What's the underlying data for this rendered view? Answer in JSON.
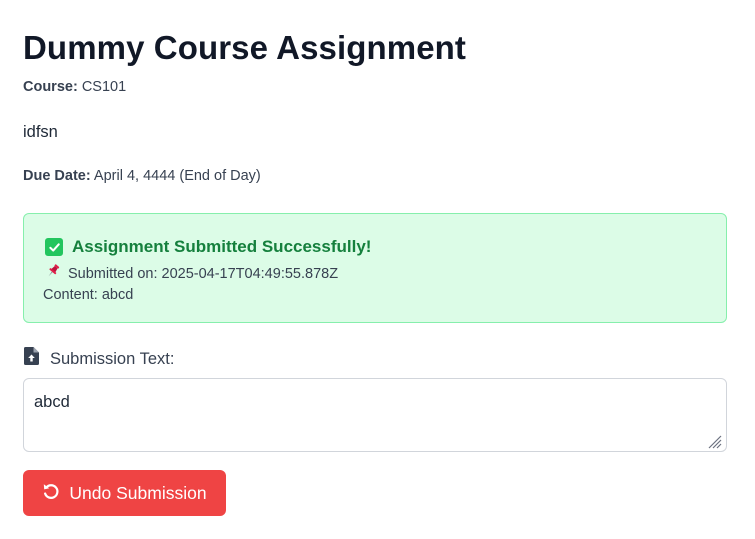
{
  "assignment": {
    "title": "Dummy Course Assignment",
    "course_label": "Course:",
    "course_value": "CS101",
    "description": "idfsn",
    "due_label": "Due Date:",
    "due_value": "April 4, 4444 (End of Day)"
  },
  "success": {
    "title": "Assignment Submitted Successfully!",
    "submitted_on": "Submitted on: 2025-04-17T04:49:55.878Z",
    "content": "Content: abcd",
    "icons": {
      "check": "check-icon",
      "pin": "pushpin-icon"
    },
    "colors": {
      "background": "#dcfce7",
      "border": "#86efac",
      "title": "#15803d"
    }
  },
  "submission": {
    "label": "Submission Text:",
    "label_icon": "file-upload-icon",
    "text_value": "abcd"
  },
  "actions": {
    "undo_label": "Undo Submission",
    "undo_icon": "undo-icon",
    "undo_color": "#ef4444"
  }
}
